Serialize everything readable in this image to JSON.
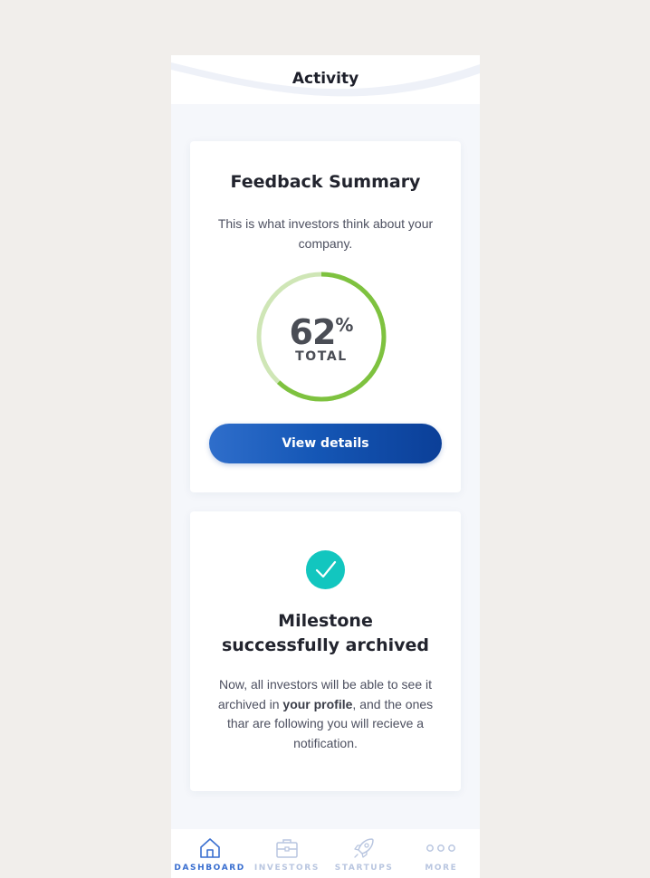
{
  "header": {
    "title": "Activity"
  },
  "feedback": {
    "title": "Feedback Summary",
    "description": "This is what investors think about your company.",
    "percent_value": "62",
    "percent_sign": "%",
    "percent_label": "TOTAL",
    "progress_fraction": 0.62,
    "button_label": "View details"
  },
  "milestone": {
    "icon": "checkmark-icon",
    "title": "Milestone successfully archived",
    "desc_before": "Now, all investors will be able to see it archived in ",
    "desc_bold": "your profile",
    "desc_after": ", and the ones thar are following you will recieve a notification."
  },
  "tabs": [
    {
      "label": "DASHBOARD",
      "icon": "home-icon",
      "active": true
    },
    {
      "label": "INVESTORS",
      "icon": "briefcase-icon",
      "active": false
    },
    {
      "label": "STARTUPS",
      "icon": "rocket-icon",
      "active": false
    },
    {
      "label": "MORE",
      "icon": "more-dots-icon",
      "active": false
    }
  ],
  "colors": {
    "page_background": "#f1eeeb",
    "ring_green": "#7ec23f",
    "ring_green_light": "#cfe6b6",
    "button_blue": "#1557b6",
    "check_teal": "#12c6bf",
    "tab_active": "#3a6fd0",
    "tab_inactive": "#b9c6e0"
  }
}
